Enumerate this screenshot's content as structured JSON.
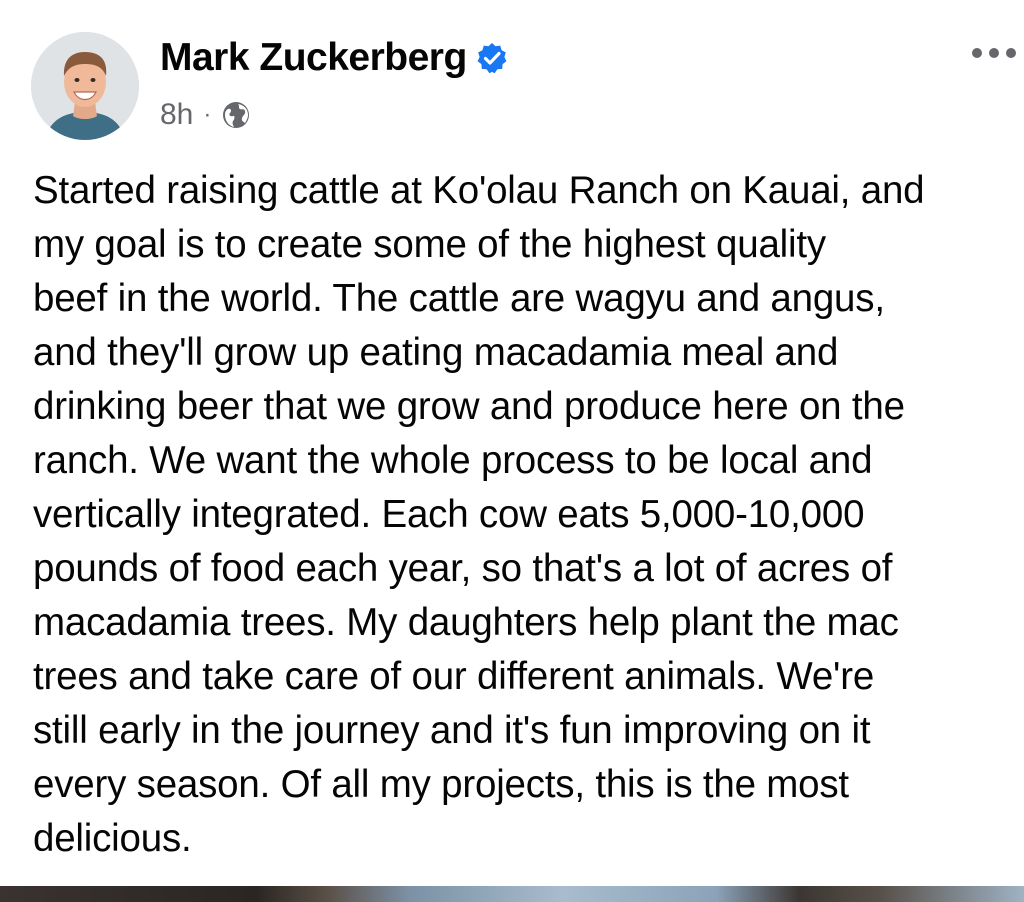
{
  "post": {
    "author": {
      "name": "Mark Zuckerberg",
      "verified": true,
      "verified_icon": "verified-badge-icon",
      "avatar": "profile-photo"
    },
    "meta": {
      "time": "8h",
      "separator": "·",
      "audience_icon": "globe-icon"
    },
    "more_icon": "more-options-icon",
    "text": "Started raising cattle at Ko'olau Ranch on Kauai, and\nmy goal is to create some of the highest quality\nbeef in the world. The cattle are wagyu and angus,\nand they'll grow up eating macadamia meal and\ndrinking beer that we grow and produce here on the\nranch. We want the whole process to be local and\nvertically integrated. Each cow eats 5,000-10,000\npounds of food each year, so that's a lot of acres of\nmacadamia trees. My daughters help plant the mac\ntrees and take care of our different animals. We're\nstill early in the journey and it's fun improving on it\nevery season. Of all my projects, this is the most\ndelicious.",
    "colors": {
      "text": "#050505",
      "secondary_text": "#65676b",
      "verified_blue": "#1877f2",
      "background": "#ffffff"
    }
  }
}
